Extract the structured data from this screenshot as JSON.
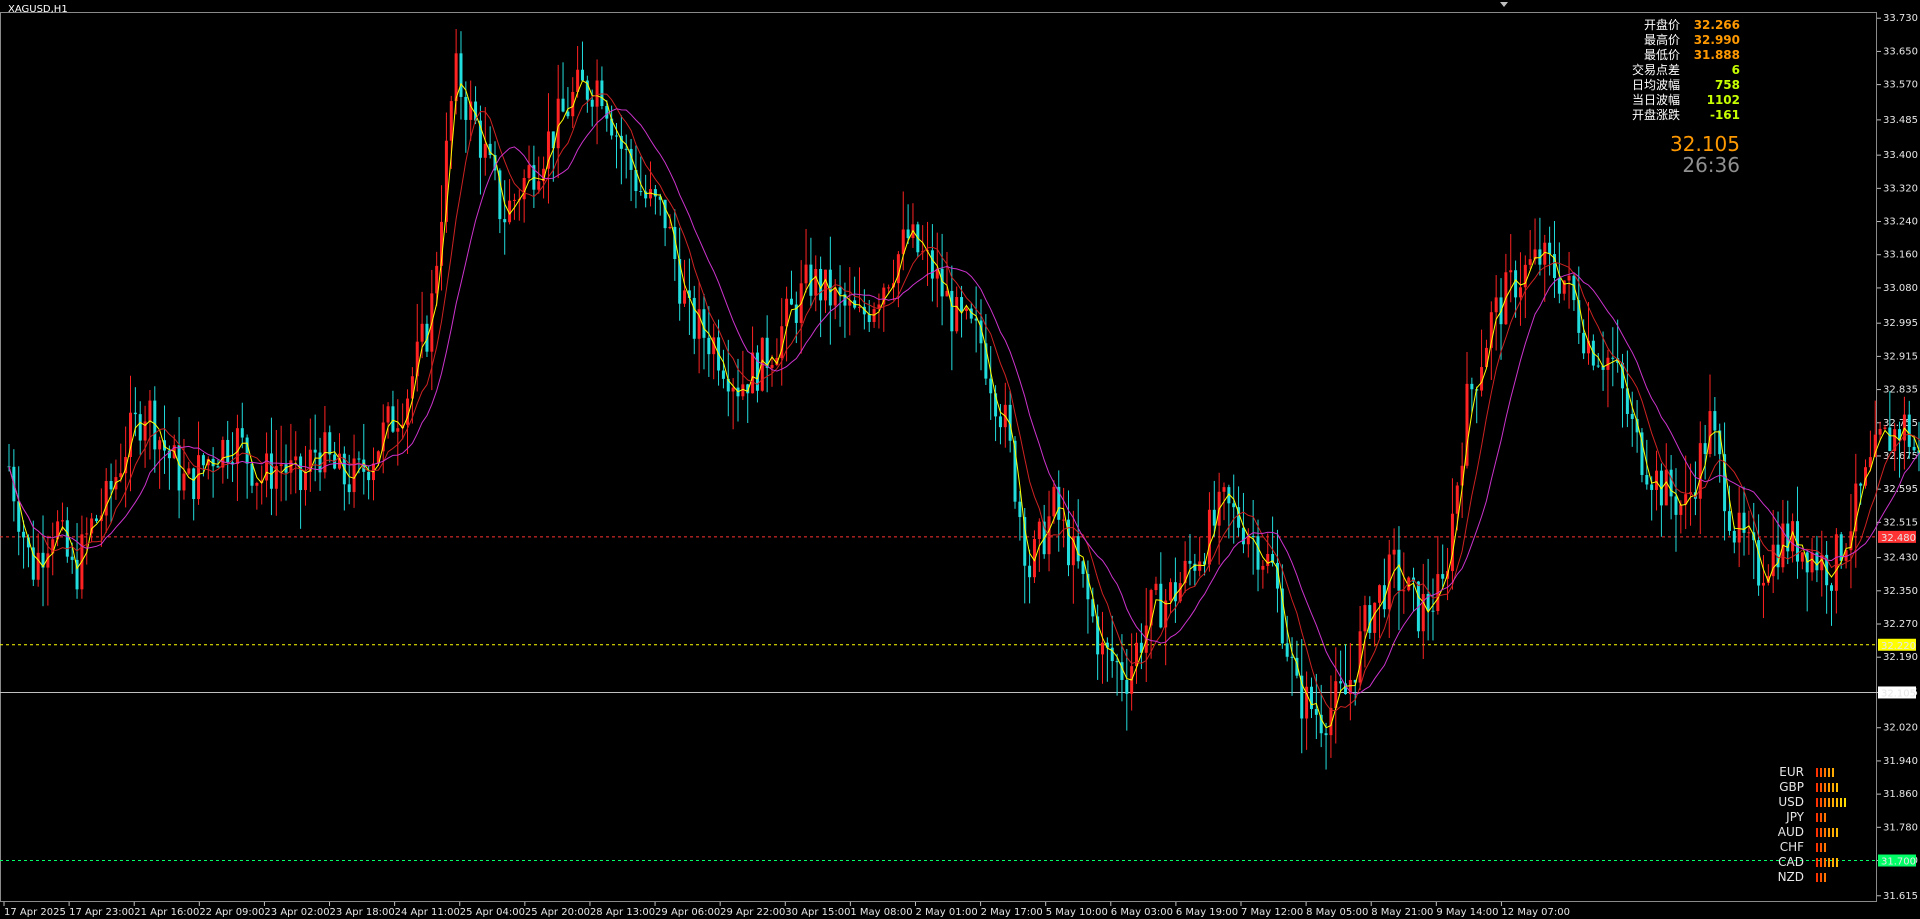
{
  "window": {
    "symbol_title": "XAGUSD,H1"
  },
  "info_panel": [
    {
      "label": "开盘价",
      "value": "32.266",
      "color": "#ff9900"
    },
    {
      "label": "最高价",
      "value": "32.990",
      "color": "#ff9900"
    },
    {
      "label": "最低价",
      "value": "31.888",
      "color": "#ff9900"
    },
    {
      "label": "交易点差",
      "value": "6",
      "color": "#c8ff00"
    },
    {
      "label": "日均波幅",
      "value": "758",
      "color": "#c8ff00"
    },
    {
      "label": "当日波幅",
      "value": "1102",
      "color": "#c8ff00"
    },
    {
      "label": "开盘涨跌",
      "value": "-161",
      "color": "#c8ff00"
    }
  ],
  "current_price": "32.105",
  "countdown": "26:36",
  "currency_strength": [
    {
      "name": "EUR",
      "level": 5
    },
    {
      "name": "GBP",
      "level": 6
    },
    {
      "name": "USD",
      "level": 8
    },
    {
      "name": "JPY",
      "level": 3
    },
    {
      "name": "AUD",
      "level": 6
    },
    {
      "name": "CHF",
      "level": 3
    },
    {
      "name": "CAD",
      "level": 6
    },
    {
      "name": "NZD",
      "level": 3
    }
  ],
  "chart_data": {
    "type": "candlestick",
    "ylim": [
      31.6,
      33.745
    ],
    "y_ticks": [
      "33.730",
      "33.650",
      "33.570",
      "33.485",
      "33.400",
      "33.320",
      "33.240",
      "33.160",
      "33.080",
      "32.995",
      "32.915",
      "32.835",
      "32.755",
      "32.675",
      "32.595",
      "32.515",
      "32.430",
      "32.350",
      "32.270",
      "32.190",
      "32.105",
      "32.020",
      "31.940",
      "31.860",
      "31.780",
      "31.700",
      "31.615"
    ],
    "x_ticks": [
      "17 Apr 2025",
      "17 Apr 23:00",
      "21 Apr 16:00",
      "22 Apr 09:00",
      "23 Apr 02:00",
      "23 Apr 18:00",
      "24 Apr 11:00",
      "25 Apr 04:00",
      "25 Apr 20:00",
      "28 Apr 13:00",
      "29 Apr 06:00",
      "29 Apr 22:00",
      "30 Apr 15:00",
      "1 May 08:00",
      "2 May 01:00",
      "2 May 17:00",
      "5 May 10:00",
      "6 May 03:00",
      "6 May 19:00",
      "7 May 12:00",
      "8 May 05:00",
      "8 May 21:00",
      "9 May 14:00",
      "12 May 07:00"
    ],
    "price_path": [
      [
        0,
        32.65
      ],
      [
        14,
        32.4
      ],
      [
        28,
        32.52
      ],
      [
        40,
        32.38
      ],
      [
        50,
        32.5
      ],
      [
        60,
        32.56
      ],
      [
        72,
        32.7
      ],
      [
        85,
        32.8
      ],
      [
        95,
        32.7
      ],
      [
        110,
        32.6
      ],
      [
        125,
        32.68
      ],
      [
        140,
        32.72
      ],
      [
        155,
        32.62
      ],
      [
        168,
        32.66
      ],
      [
        180,
        32.6
      ],
      [
        190,
        32.7
      ],
      [
        205,
        32.62
      ],
      [
        215,
        32.62
      ],
      [
        230,
        32.72
      ],
      [
        245,
        32.82
      ],
      [
        260,
        33.0
      ],
      [
        275,
        33.6
      ],
      [
        290,
        33.45
      ],
      [
        305,
        33.25
      ],
      [
        320,
        33.35
      ],
      [
        335,
        33.45
      ],
      [
        350,
        33.55
      ],
      [
        365,
        33.58
      ],
      [
        378,
        33.42
      ],
      [
        392,
        33.3
      ],
      [
        405,
        33.25
      ],
      [
        420,
        33.0
      ],
      [
        435,
        32.95
      ],
      [
        450,
        32.85
      ],
      [
        465,
        32.9
      ],
      [
        480,
        33.0
      ],
      [
        495,
        33.1
      ],
      [
        510,
        33.05
      ],
      [
        525,
        33.0
      ],
      [
        540,
        33.1
      ],
      [
        555,
        33.2
      ],
      [
        570,
        33.12
      ],
      [
        585,
        33.0
      ],
      [
        600,
        32.95
      ],
      [
        615,
        32.75
      ],
      [
        630,
        32.4
      ],
      [
        645,
        32.55
      ],
      [
        660,
        32.4
      ],
      [
        675,
        32.2
      ],
      [
        690,
        32.15
      ],
      [
        705,
        32.3
      ],
      [
        720,
        32.35
      ],
      [
        735,
        32.45
      ],
      [
        750,
        32.55
      ],
      [
        765,
        32.5
      ],
      [
        780,
        32.4
      ],
      [
        795,
        32.1
      ],
      [
        810,
        32.05
      ],
      [
        825,
        32.1
      ],
      [
        840,
        32.3
      ],
      [
        855,
        32.4
      ],
      [
        870,
        32.3
      ],
      [
        885,
        32.35
      ],
      [
        900,
        32.8
      ],
      [
        915,
        33.0
      ],
      [
        930,
        33.1
      ],
      [
        945,
        33.15
      ],
      [
        960,
        33.1
      ],
      [
        975,
        32.95
      ],
      [
        990,
        32.9
      ],
      [
        1005,
        32.7
      ],
      [
        1020,
        32.6
      ],
      [
        1035,
        32.55
      ],
      [
        1050,
        32.75
      ],
      [
        1065,
        32.5
      ],
      [
        1080,
        32.4
      ],
      [
        1095,
        32.48
      ],
      [
        1110,
        32.45
      ],
      [
        1125,
        32.4
      ],
      [
        1140,
        32.55
      ],
      [
        1155,
        32.7
      ],
      [
        1170,
        32.75
      ],
      [
        1185,
        32.6
      ],
      [
        1200,
        32.8
      ],
      [
        1210,
        32.95
      ],
      [
        1215,
        32.1
      ],
      [
        1218,
        31.9
      ],
      [
        1222,
        32.12
      ]
    ],
    "candle_noise": 0.06,
    "horizontal_lines": [
      {
        "name": "red-dashed-level",
        "price": 32.48,
        "label": "32.480",
        "color": "#ff3333",
        "style": "dashed"
      },
      {
        "name": "yellow-dashed-level",
        "price": 32.22,
        "label": "32.220",
        "color": "#ffff00",
        "style": "dashed"
      },
      {
        "name": "current-price-line",
        "price": 32.105,
        "label": "32.105",
        "color": "#c0c0c0",
        "style": "solid"
      },
      {
        "name": "green-dashed-level",
        "price": 31.7,
        "label": "31.700",
        "color": "#00ff66",
        "style": "dashed"
      }
    ],
    "box": {
      "from_bar": 1216,
      "to_bar": 1457,
      "price_top": 32.22,
      "price_bottom": 31.7,
      "color": "#0000ff"
    },
    "arrows": [
      {
        "from": [
          1218,
          32.1
        ],
        "to": [
          1254,
          32.22
        ],
        "color": "#ffa500"
      },
      {
        "from": [
          1257,
          32.22
        ],
        "to": [
          1362,
          31.7
        ],
        "color": "#ffa500"
      }
    ],
    "moving_averages": [
      {
        "name": "ma-yellow",
        "color": "#ffff00",
        "window": 10
      },
      {
        "name": "ma-red",
        "color": "#cc2222",
        "window": 25
      },
      {
        "name": "ma-magenta",
        "color": "#cc33cc",
        "window": 45
      }
    ]
  }
}
